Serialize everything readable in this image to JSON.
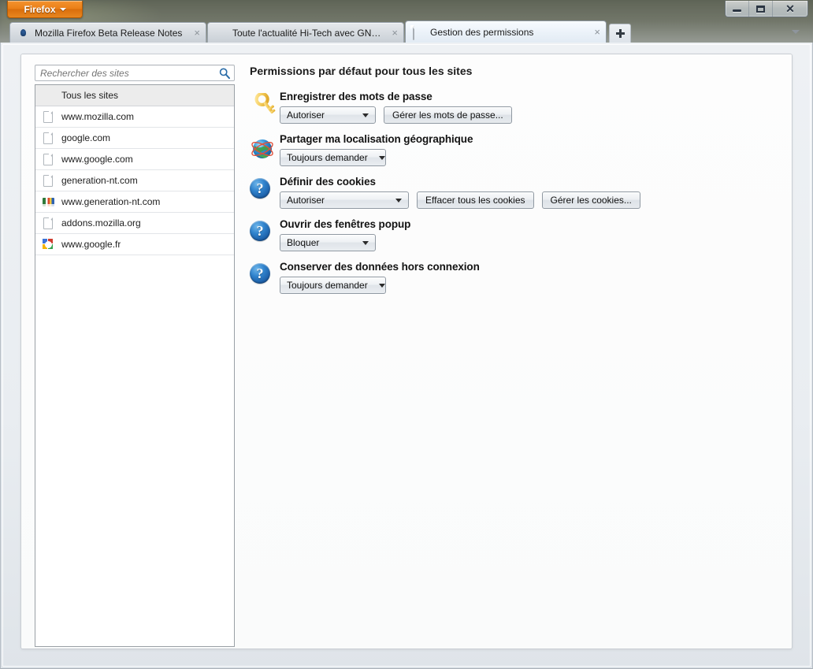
{
  "window": {
    "app_button_label": "Firefox",
    "controls": {
      "minimize": "minimize-icon",
      "maximize": "maximize-icon",
      "close": "close-icon"
    }
  },
  "tabs": [
    {
      "title": "Mozilla Firefox Beta Release Notes",
      "favicon": "firefox-icon",
      "close": "×",
      "active": false
    },
    {
      "title": "Toute l'actualité Hi-Tech avec GNT : I...",
      "favicon": "gnt-icon",
      "close": "×",
      "active": false
    },
    {
      "title": "Gestion des permissions",
      "favicon": "document-icon",
      "close": "×",
      "active": true
    }
  ],
  "newtab": {
    "label": "+",
    "name": "new-tab-button"
  },
  "tablist": {
    "name": "tab-list-dropdown"
  },
  "search": {
    "placeholder": "Rechercher des sites",
    "value": "",
    "icon": "search-icon"
  },
  "sites": {
    "header": {
      "label": "Tous les sites",
      "selected": true
    },
    "items": [
      {
        "label": "www.mozilla.com",
        "icon": "document-icon"
      },
      {
        "label": "google.com",
        "icon": "document-icon"
      },
      {
        "label": "www.google.com",
        "icon": "document-icon"
      },
      {
        "label": "generation-nt.com",
        "icon": "document-icon"
      },
      {
        "label": "www.generation-nt.com",
        "icon": "gnt-icon"
      },
      {
        "label": "addons.mozilla.org",
        "icon": "document-icon"
      },
      {
        "label": "www.google.fr",
        "icon": "google-icon"
      }
    ]
  },
  "permissions": {
    "title": "Permissions par défaut pour tous les sites",
    "blocks": [
      {
        "icon": "key-icon",
        "label": "Enregistrer des mots de passe",
        "select": "Autoriser",
        "buttons": [
          "Gérer les mots de passe..."
        ]
      },
      {
        "icon": "globe-icon",
        "label": "Partager ma localisation géographique",
        "select": "Toujours demander",
        "buttons": []
      },
      {
        "icon": "help-icon",
        "label": "Définir des cookies",
        "select": "Autoriser",
        "buttons": [
          "Effacer tous les cookies",
          "Gérer les cookies..."
        ]
      },
      {
        "icon": "help-icon",
        "label": "Ouvrir des fenêtres popup",
        "select": "Bloquer",
        "buttons": []
      },
      {
        "icon": "help-icon",
        "label": "Conserver des données hors connexion",
        "select": "Toujours demander",
        "buttons": []
      }
    ]
  },
  "colors": {
    "accent_orange": "#ea7f17",
    "help_blue": "#1d5fa8",
    "key_gold": "#f0c24a"
  }
}
